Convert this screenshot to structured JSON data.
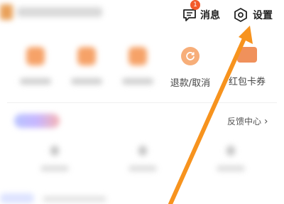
{
  "header": {
    "message_label": "消息",
    "message_badge": "1",
    "settings_label": "设置"
  },
  "orders": {
    "refund_label": "退款/取消",
    "coupon_label": "红包卡券"
  },
  "assets": {
    "feedback_label": "反馈中心",
    "feedback_chevron": "›"
  },
  "colors": {
    "accent": "#f7931e",
    "badge": "#f25a2a"
  },
  "icons": [
    "message-icon",
    "settings-icon",
    "refund-icon",
    "coupon-icon",
    "arrow-annotation"
  ]
}
